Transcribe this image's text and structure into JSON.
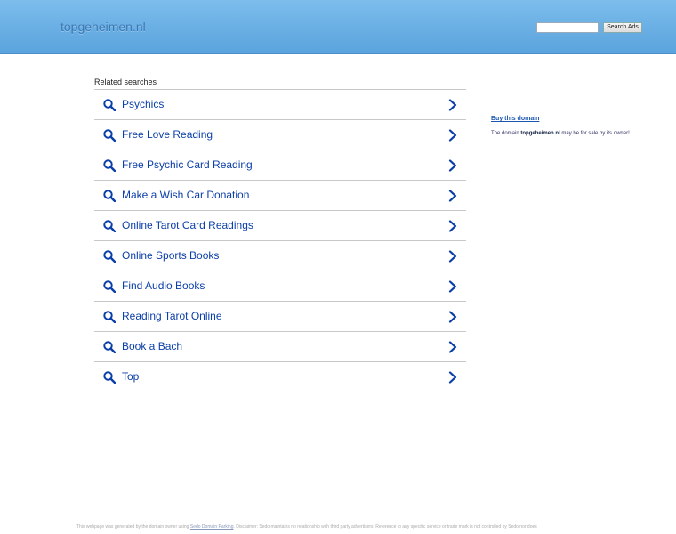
{
  "header": {
    "domain": "topgeheimen.nl",
    "search_placeholder": "",
    "search_button": "Search Ads"
  },
  "related": {
    "title": "Related searches",
    "items": [
      {
        "label": "Psychics"
      },
      {
        "label": "Free Love Reading"
      },
      {
        "label": "Free Psychic Card Reading"
      },
      {
        "label": "Make a Wish Car Donation"
      },
      {
        "label": "Online Tarot Card Readings"
      },
      {
        "label": "Online Sports Books"
      },
      {
        "label": "Find Audio Books"
      },
      {
        "label": "Reading Tarot Online"
      },
      {
        "label": "Book a Bach"
      },
      {
        "label": "Top"
      }
    ]
  },
  "sidebar": {
    "buy_link": "Buy this domain",
    "sale_prefix": "The domain ",
    "sale_domain": "topgeheimen.nl",
    "sale_suffix": " may be for sale by its owner!"
  },
  "footer": {
    "prefix": "This webpage was generated by the domain owner using ",
    "link": "Sedo Domain Parking",
    "suffix": ". Disclaimer: Sedo maintains no relationship with third party advertisers. Reference to any specific service or trade mark is not controlled by Sedo nor does"
  },
  "colors": {
    "accent": "#0b3fa8",
    "header_top": "#7cbdec",
    "header_bottom": "#5aa3dd"
  }
}
